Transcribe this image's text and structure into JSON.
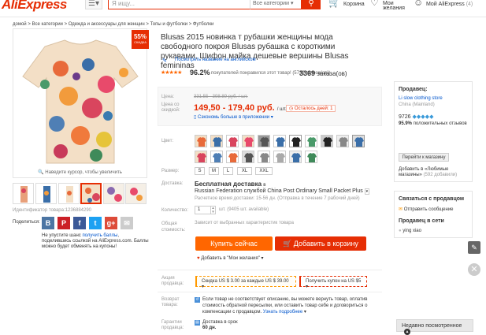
{
  "header": {
    "logo": "AliExpress",
    "menu_icon": "menu-icon",
    "search_placeholder": "Я ищу...",
    "search_category": "Все категории",
    "cart": "Корзина",
    "wishlist": "Мои желания",
    "account": "Мой AliExpress",
    "account_count": "(4)",
    "accent_color": "#e62e04"
  },
  "breadcrumbs": "домой > Все категории > Одежда и аксессуары для женщин > Топы и футболки > Футболки",
  "gallery": {
    "discount_badge": "55%",
    "discount_sub": "СКИДКА",
    "hover_hint": "Наведите курсор, чтобы увеличить",
    "product_id": "Идентификатор товара:1236884290"
  },
  "share": {
    "label": "Поделиться:",
    "buttons": [
      "vk-icon",
      "pinterest-icon",
      "facebook-icon",
      "twitter-icon",
      "googleplus-icon",
      "email-icon"
    ],
    "promo_pre": "Не упустите шанс ",
    "promo_link": "получить баллы",
    "promo_post": ", поделившись ссылкой на AliExpress.com. Баллы можно будет обменять на купоны!"
  },
  "product": {
    "title": "Blusas 2015 новинка т рубашки женщины мода свободного покроя Blusas рубашка с короткими рукавами, Шифон майка дешевые вершины Blusas femininas",
    "translate_link": "Посмотреть название на английском",
    "stars": "★★★★★",
    "rating": "96.2%",
    "rating_text": "покупателей понравился этот товар! (5739 голоса(ов))",
    "orders_count": "3369",
    "orders_label": "заказа(ов)"
  },
  "price": {
    "label_price": "Цена:",
    "label_discount": "Цена со скидкой:",
    "old_price": "331.55 - 398.89 руб. / шт.",
    "new_price": "149,50 - 179,40 руб.",
    "unit": "/ шт.",
    "days_left": "Осталось дней: 1",
    "app_save": "Сэкономь больше в приложении"
  },
  "options": {
    "color_label": "Цвет:",
    "size_label": "Размер:",
    "sizes": [
      "S",
      "M",
      "L",
      "XL",
      "XXL"
    ],
    "delivery_label": "Доставка:",
    "delivery_free": "Бесплатная доставка",
    "delivery_to": "в",
    "delivery_service": "Russian Federation службой China Post Ordinary Small Packet Plus",
    "delivery_time": "Расчетное время доставки: 15-56 дн. (Отправка в течение 7 рабочий дней)",
    "qty_label": "Количество:",
    "qty_value": "1",
    "qty_avail": "шт. (9405 шт. available)",
    "total_label": "Общая стоимость:",
    "total_note": "Зависит от выбранных характеристик товара"
  },
  "actions": {
    "buy_now": "Купить сейчас",
    "add_cart": "Добавить в корзину",
    "wishlist": "Добавить в \"Мои желания\""
  },
  "promo": {
    "label": "Акция продавца:",
    "coupon1": "Скидка US $ 3.00 за каждые US $ 39.00",
    "coupon2": "Получить купон на US $5"
  },
  "guarantee": {
    "return_label": "Возврат товара:",
    "return_text": "Если товар не соответствует описанию, вы можете вернуть товар, оплатив стоимость обратной пересылки, или оставить товар себе и договориться о компенсации с продавцом.",
    "return_link": "Узнать подробнее",
    "warranty_label": "Гарантии продавца:",
    "delivery_days": "Доставка в срок",
    "delivery_days2": "60 дн."
  },
  "seller": {
    "heading": "Продавец:",
    "name": "Li slow clothing store",
    "country": "China (Mainland)",
    "score": "9726",
    "positive": "95.9%",
    "positive_text": "положительных отзывов",
    "store_button": "Перейти к магазину",
    "favorite": "Добавить в «Любимые магазины»",
    "favorite_count": "(592 добавили)",
    "contact_heading": "Связаться с продавцом",
    "send_msg": "Отправить сообщение",
    "online_heading": "Продавец в сети",
    "online_name": "ying xiao"
  },
  "recent": "Недавно посмотренное"
}
